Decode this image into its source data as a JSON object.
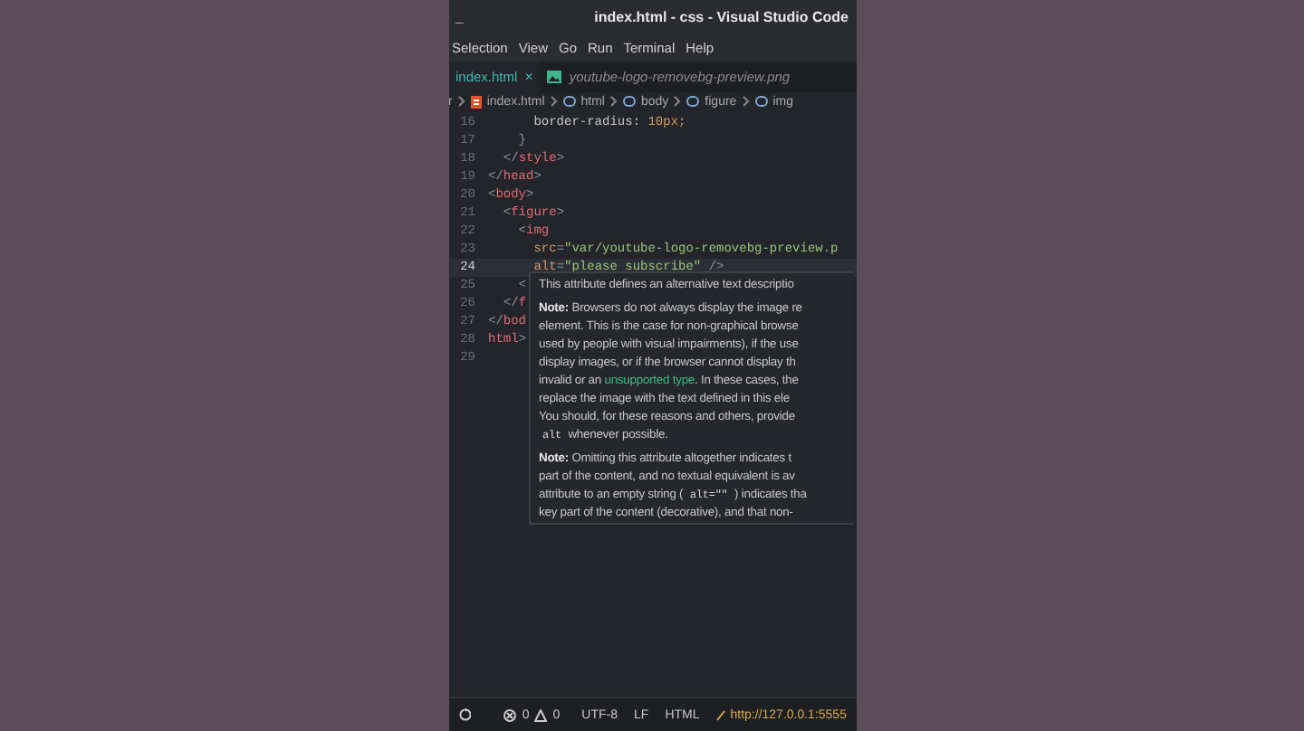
{
  "window": {
    "title": "index.html - css - Visual Studio Code",
    "minimize": "_"
  },
  "menu": [
    "Selection",
    "View",
    "Go",
    "Run",
    "Terminal",
    "Help"
  ],
  "tabs": [
    {
      "label": "index.html",
      "selected": true,
      "kind": "html",
      "close": "×"
    },
    {
      "label": "youtube-logo-removebg-preview.png",
      "selected": false,
      "kind": "image"
    }
  ],
  "breadcrumb": [
    {
      "label": "r",
      "kind": "folder"
    },
    {
      "label": "index.html",
      "kind": "file"
    },
    {
      "label": "html",
      "kind": "element"
    },
    {
      "label": "body",
      "kind": "element"
    },
    {
      "label": "figure",
      "kind": "element"
    },
    {
      "label": "img",
      "kind": "element"
    }
  ],
  "editor": {
    "lines": [
      {
        "number": "16",
        "current": false,
        "segments": [
          {
            "text": "      border-radius: ",
            "kind": "prop"
          },
          {
            "text": "10px;",
            "kind": "num"
          }
        ]
      },
      {
        "number": "17",
        "current": false,
        "segments": [
          {
            "text": "    }",
            "kind": "punct"
          }
        ]
      },
      {
        "number": "18",
        "current": false,
        "segments": [
          {
            "text": "  </",
            "kind": "punct"
          },
          {
            "text": "style",
            "kind": "tag"
          },
          {
            "text": ">",
            "kind": "punct"
          }
        ]
      },
      {
        "number": "19",
        "current": false,
        "segments": [
          {
            "text": "</",
            "kind": "punct"
          },
          {
            "text": "head",
            "kind": "tag"
          },
          {
            "text": ">",
            "kind": "punct"
          }
        ]
      },
      {
        "number": "20",
        "current": false,
        "segments": [
          {
            "text": "<",
            "kind": "punct"
          },
          {
            "text": "body",
            "kind": "tag"
          },
          {
            "text": ">",
            "kind": "punct"
          }
        ]
      },
      {
        "number": "21",
        "current": false,
        "segments": [
          {
            "text": "  <",
            "kind": "punct"
          },
          {
            "text": "figure",
            "kind": "tag"
          },
          {
            "text": ">",
            "kind": "punct"
          }
        ]
      },
      {
        "number": "22",
        "current": false,
        "segments": [
          {
            "text": "    <",
            "kind": "punct"
          },
          {
            "text": "img",
            "kind": "tag"
          }
        ]
      },
      {
        "number": "23",
        "current": false,
        "segments": [
          {
            "text": "      src",
            "kind": "attr"
          },
          {
            "text": "=",
            "kind": "punct"
          },
          {
            "text": "\"var/youtube-logo-removebg-preview.p",
            "kind": "string"
          }
        ]
      },
      {
        "number": "24",
        "current": true,
        "segments": [
          {
            "text": "      alt",
            "kind": "attr"
          },
          {
            "text": "=",
            "kind": "punct"
          },
          {
            "text": "\"please subscribe\"",
            "kind": "string"
          },
          {
            "text": " />",
            "kind": "punct"
          }
        ]
      },
      {
        "number": "25",
        "current": false,
        "segments": [
          {
            "text": "    <",
            "kind": "punct"
          }
        ]
      },
      {
        "number": "26",
        "current": false,
        "segments": [
          {
            "text": "  </",
            "kind": "punct"
          },
          {
            "text": "f",
            "kind": "tag"
          }
        ]
      },
      {
        "number": "27",
        "current": false,
        "segments": [
          {
            "text": "</",
            "kind": "punct"
          },
          {
            "text": "bod",
            "kind": "tag"
          }
        ]
      },
      {
        "number": "28",
        "current": false,
        "segments": [
          {
            "text": "html",
            "kind": "tag"
          },
          {
            "text": ">",
            "kind": "punct"
          }
        ]
      },
      {
        "number": "29",
        "current": false
      }
    ]
  },
  "tooltip": {
    "paragraphs": [
      [
        [
          {
            "text": "This attribute defines an alternative text descriptio",
            "kind": "text"
          }
        ]
      ],
      [
        [
          {
            "text": "Note:",
            "kind": "bold"
          },
          {
            "text": " Browsers do not always display the image re",
            "kind": "text"
          }
        ],
        [
          {
            "text": "element. This is the case for non-graphical browse",
            "kind": "text"
          }
        ],
        [
          {
            "text": "used by people with visual impairments), if the use",
            "kind": "text"
          }
        ],
        [
          {
            "text": "display images, or if the browser cannot display th",
            "kind": "text"
          }
        ],
        [
          {
            "text": "invalid or an ",
            "kind": "text"
          },
          {
            "text": "unsupported type",
            "kind": "link"
          },
          {
            "text": ". In these cases, the",
            "kind": "text"
          }
        ],
        [
          {
            "text": "replace the image with the text defined in this ele",
            "kind": "text"
          }
        ],
        [
          {
            "text": "You should, for these reasons and others, provide",
            "kind": "text"
          }
        ],
        [
          {
            "text": "alt",
            "kind": "code"
          },
          {
            "text": " whenever possible.",
            "kind": "text"
          }
        ]
      ],
      [
        [
          {
            "text": "Note:",
            "kind": "bold"
          },
          {
            "text": " Omitting this attribute altogether indicates t",
            "kind": "text"
          }
        ],
        [
          {
            "text": "part of the content, and no textual equivalent is av",
            "kind": "text"
          }
        ],
        [
          {
            "text": "attribute to an empty string ( ",
            "kind": "text"
          },
          {
            "text": "alt=\"\"",
            "kind": "code"
          },
          {
            "text": " ) indicates tha",
            "kind": "text"
          }
        ],
        [
          {
            "text": "key part of the content (decorative), and that non-",
            "kind": "text"
          }
        ]
      ]
    ]
  },
  "status_bar": [
    {
      "kind": "sync"
    },
    {
      "kind": "errors",
      "text": "0"
    },
    {
      "kind": "warnings",
      "text": "0"
    },
    {
      "kind": "text",
      "text": "UTF-8"
    },
    {
      "kind": "text",
      "text": "LF"
    },
    {
      "kind": "text",
      "text": "HTML"
    },
    {
      "kind": "server",
      "text": "http://127.0.0.1:5555"
    }
  ]
}
